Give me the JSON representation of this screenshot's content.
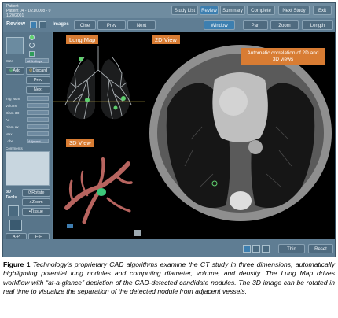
{
  "topbar": {
    "patient_line1": "Patient",
    "patient_line2": "Patient 04 - 1/21/0008 - 0",
    "patient_line3": "1/20/2001",
    "buttons": [
      "Study List",
      "Review",
      "Summary",
      "Complete",
      "Next Study",
      "Exit"
    ]
  },
  "toolbar": {
    "review_label": "Review",
    "images_label": "Images",
    "cine": "Cine",
    "prev": "Prev",
    "next": "Next",
    "window": "Window",
    "pan": "Pan",
    "zoom": "Zoom",
    "length": "Length"
  },
  "leftpanel": {
    "size_label": "Size",
    "size_value": "All findings",
    "add": "Add",
    "discard": "Discard",
    "prev": "Prev",
    "next": "Next",
    "rows": [
      "Img Num",
      "Volume",
      "Diam 3D",
      "Ax",
      "Diam Ax",
      "Max",
      "Lobe",
      "Comments"
    ],
    "lobe_value": "Adjacent",
    "tools_label": "3D Tools",
    "rotate": "Rotate",
    "zoom": "Zoom",
    "tissue": "Tissue",
    "ap": "A-P",
    "fh": "F-H"
  },
  "panes": {
    "lung_map": "Lung Map",
    "view3d": "3D View",
    "view2d": "2D View",
    "callout": "Automatic correlation of 2D and 3D views"
  },
  "bottombar": {
    "thin": "Thin",
    "reset": "Reset"
  },
  "caption": {
    "figure": "Figure 1",
    "text": " Technology’s proprietary CAD algorithms examine the CT study in three dimensions, automatically highlighting potential lung nodules and computing diameter, volume, and density. The Lung Map drives workflow with “at-a-glance” depiction of the CAD-detected candidate nodules. The 3D image can be rotated in real time to visualize the separation of the detected nodule from adjacent vessels."
  },
  "colors": {
    "panel_bg": "#5f7d93",
    "accent_orange": "#d87c33",
    "nodule_green": "#5fd06e"
  }
}
